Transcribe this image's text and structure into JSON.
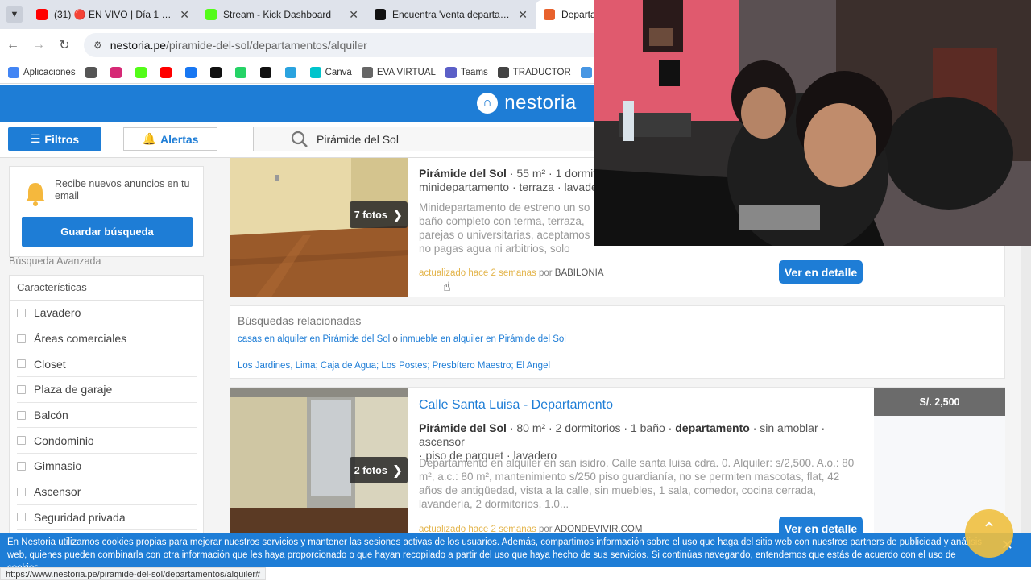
{
  "browser": {
    "tabs": [
      {
        "label": "(31) 🔴 EN VIVO | Día 1 del De",
        "icon": "youtube-icon",
        "color": "#ff0000",
        "active": false
      },
      {
        "label": "Stream - Kick Dashboard",
        "icon": "kick-icon",
        "color": "#53fc18",
        "active": false
      },
      {
        "label": "Encuentra 'venta departamento",
        "icon": "tiktok-icon",
        "color": "#111111",
        "active": false
      },
      {
        "label": "Departam",
        "icon": "nestoria-icon",
        "color": "#e8612c",
        "active": true
      }
    ],
    "url_host": "nestoria.pe",
    "url_path": "/piramide-del-sol/departamentos/alquiler",
    "bookmarks": [
      {
        "label": "Aplicaciones",
        "icon": "apps-grid-icon",
        "color": "#4285f4"
      },
      {
        "label": "",
        "icon": "grid-icon",
        "color": "#555555"
      },
      {
        "label": "",
        "icon": "instagram-icon",
        "color": "#d62976"
      },
      {
        "label": "",
        "icon": "kick-icon",
        "color": "#53fc18"
      },
      {
        "label": "",
        "icon": "youtube-icon",
        "color": "#ff0000"
      },
      {
        "label": "",
        "icon": "facebook-icon",
        "color": "#1877f2"
      },
      {
        "label": "",
        "icon": "x-icon",
        "color": "#111111"
      },
      {
        "label": "",
        "icon": "whatsapp-icon",
        "color": "#25d366"
      },
      {
        "label": "",
        "icon": "tiktok-icon",
        "color": "#111111"
      },
      {
        "label": "",
        "icon": "telegram-icon",
        "color": "#2aa3df"
      },
      {
        "label": "Canva",
        "icon": "canva-icon",
        "color": "#00c4cc"
      },
      {
        "label": "EVA VIRTUAL",
        "icon": "eva-icon",
        "color": "#666666"
      },
      {
        "label": "Teams",
        "icon": "teams-icon",
        "color": "#5b5fc7"
      },
      {
        "label": "TRADUCTOR",
        "icon": "translate-icon",
        "color": "#444444"
      },
      {
        "label": "Gimini I",
        "icon": "gemini-icon",
        "color": "#4796e3"
      }
    ]
  },
  "site": {
    "logo_text": "nestoria",
    "brand_color": "#1e7dd6",
    "filters_label": "Filtros",
    "alerts_label": "Alertas",
    "search_value": "Pirámide del Sol"
  },
  "sidebar": {
    "notify_text": "Recibe nuevos anuncios en tu email",
    "save_label": "Guardar búsqueda",
    "advanced_label": "Búsqueda Avanzada",
    "features_header": "Características",
    "features": [
      "Lavadero",
      "Áreas comerciales",
      "Closet",
      "Plaza de garaje",
      "Balcón",
      "Condominio",
      "Gimnasio",
      "Ascensor",
      "Seguridad privada"
    ]
  },
  "listings": [
    {
      "photos_label": "7 fotos",
      "loc": "Pirámide del Sol",
      "specs_rest": " · 55 m² · 1 dormito",
      "specs_line2": "minidepartamento · terraza · lavade",
      "desc": "Minidepartamento de estreno un so baño completo con terma, terraza, parejas o universitarias, aceptamos no pagas agua ni arbitrios, solo pagas lu...",
      "updated": "actualizado hace 2 semanas",
      "by_word": "por",
      "source": "BABILONIA",
      "cta": "Ver en detalle"
    },
    {
      "title": "Calle Santa Luisa - Departamento",
      "price": "S/. 2,500",
      "photos_label": "2 fotos",
      "loc": "Pirámide del Sol",
      "specs_mid": " · 80 m² · 2 dormitorios · 1 baño · ",
      "specs_type": "departamento",
      "specs_end": " · sin amoblar · ascensor",
      "specs_line2": "· piso de parquet · lavadero",
      "desc": "Departamento en alquiler en san isidro. Calle santa luisa cdra. 0. Alquiler: s/2,500. A.o.: 80 m², a.c.: 80 m², mantenimiento s/250 piso guardianía, no se permiten mascotas, flat, 42 años de antigüedad, vista a la calle, sin muebles, 1 sala, comedor, cocina cerrada, lavandería, 2 dormitorios, 1.0...",
      "updated": "actualizado hace 2 semanas",
      "by_word": "por",
      "source": "ADONDEVIVIR.COM",
      "cta": "Ver en detalle"
    }
  ],
  "related": {
    "heading": "Búsquedas relacionadas",
    "link_a": "casas en alquiler en Pirámide del Sol",
    "conj": " o ",
    "link_b": "inmueble en alquiler en Pirámide del Sol",
    "neighborhoods": "Los Jardines, Lima; Caja de Agua; Los Postes; Presbítero Maestro; El Angel"
  },
  "cookie": {
    "text": "En Nestoria utilizamos cookies propias para mejorar nuestros servicios y mantener las sesiones activas de los usuarios. Además, compartimos información sobre el uso que haga del sitio web con nuestros partners de publicidad y análisis web, quienes pueden combinarla con otra información que les haya proporcionado o que hayan recopilado a partir del uso que haya hecho de sus servicios. Si continúas navegando, entendemos que estás de acuerdo con el uso de cookies.",
    "close": "✕"
  },
  "status_url": "https://www.nestoria.pe/piramide-del-sol/departamentos/alquiler#"
}
